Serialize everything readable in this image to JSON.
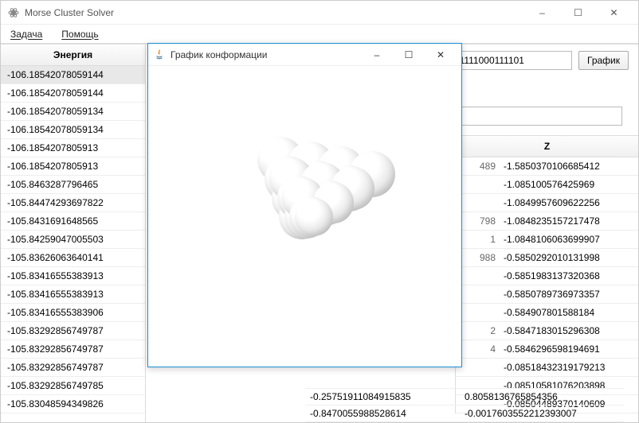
{
  "window": {
    "title": "Morse Cluster Solver",
    "controls": {
      "min": "–",
      "max": "☐",
      "close": "✕"
    }
  },
  "menu": {
    "task": "Задача",
    "help": "Помощь"
  },
  "sidebar": {
    "header": "Энергия",
    "items": [
      "-106.18542078059144",
      "-106.18542078059144",
      "-106.18542078059134",
      "-106.18542078059134",
      "-106.1854207805913",
      "-106.1854207805913",
      "-105.8463287796465",
      "-105.84474293697822",
      "-105.8431691648565",
      "-105.84259047005503",
      "-105.83626063640141",
      "-105.83416555383913",
      "-105.83416555383913",
      "-105.83416555383906",
      "-105.83292856749787",
      "-105.83292856749787",
      "-105.83292856749787",
      "-105.83292856749785",
      "-105.83048594349826"
    ],
    "selected_index": 0
  },
  "top_row": {
    "code_value": "111111000111101",
    "graph_button": "График"
  },
  "z_column": {
    "header": "Z",
    "rows": [
      {
        "frag": "489",
        "z": "-1.5850370106685412"
      },
      {
        "frag": "",
        "z": "-1.085100576425969"
      },
      {
        "frag": "",
        "z": "-1.0849957609622256"
      },
      {
        "frag": "798",
        "z": "-1.0848235157217478"
      },
      {
        "frag": "1",
        "z": "-1.0848106063699907"
      },
      {
        "frag": "988",
        "z": "-0.5850292010131998"
      },
      {
        "frag": "",
        "z": "-0.5851983137320368"
      },
      {
        "frag": "",
        "z": "-0.5850789736973357"
      },
      {
        "frag": "",
        "z": "-0.584907801588184"
      },
      {
        "frag": "2",
        "z": "-0.5847183015296308"
      },
      {
        "frag": "4",
        "z": "-0.5846296598194691"
      },
      {
        "frag": "",
        "z": "-0.08518432319179213"
      },
      {
        "frag": "",
        "z": "-0.08510581076203898"
      },
      {
        "frag": "",
        "z": "-0.08504489370140609"
      }
    ]
  },
  "bottom_rows": [
    {
      "a": "-0.25751911084915835",
      "b": "0.8058136765854356"
    },
    {
      "a": "-0.8470055988528614",
      "b": "-0.0017603552212393007"
    }
  ],
  "dialog": {
    "title": "График конформации",
    "controls": {
      "min": "–",
      "max": "☐",
      "close": "✕"
    }
  }
}
